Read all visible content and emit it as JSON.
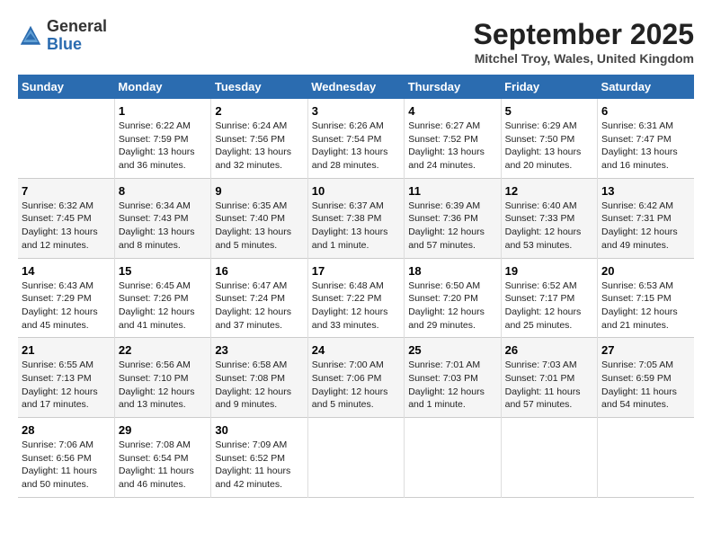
{
  "header": {
    "logo_general": "General",
    "logo_blue": "Blue",
    "month_title": "September 2025",
    "location": "Mitchel Troy, Wales, United Kingdom"
  },
  "days_of_week": [
    "Sunday",
    "Monday",
    "Tuesday",
    "Wednesday",
    "Thursday",
    "Friday",
    "Saturday"
  ],
  "weeks": [
    [
      {
        "day": "",
        "info": ""
      },
      {
        "day": "1",
        "info": "Sunrise: 6:22 AM\nSunset: 7:59 PM\nDaylight: 13 hours\nand 36 minutes."
      },
      {
        "day": "2",
        "info": "Sunrise: 6:24 AM\nSunset: 7:56 PM\nDaylight: 13 hours\nand 32 minutes."
      },
      {
        "day": "3",
        "info": "Sunrise: 6:26 AM\nSunset: 7:54 PM\nDaylight: 13 hours\nand 28 minutes."
      },
      {
        "day": "4",
        "info": "Sunrise: 6:27 AM\nSunset: 7:52 PM\nDaylight: 13 hours\nand 24 minutes."
      },
      {
        "day": "5",
        "info": "Sunrise: 6:29 AM\nSunset: 7:50 PM\nDaylight: 13 hours\nand 20 minutes."
      },
      {
        "day": "6",
        "info": "Sunrise: 6:31 AM\nSunset: 7:47 PM\nDaylight: 13 hours\nand 16 minutes."
      }
    ],
    [
      {
        "day": "7",
        "info": "Sunrise: 6:32 AM\nSunset: 7:45 PM\nDaylight: 13 hours\nand 12 minutes."
      },
      {
        "day": "8",
        "info": "Sunrise: 6:34 AM\nSunset: 7:43 PM\nDaylight: 13 hours\nand 8 minutes."
      },
      {
        "day": "9",
        "info": "Sunrise: 6:35 AM\nSunset: 7:40 PM\nDaylight: 13 hours\nand 5 minutes."
      },
      {
        "day": "10",
        "info": "Sunrise: 6:37 AM\nSunset: 7:38 PM\nDaylight: 13 hours\nand 1 minute."
      },
      {
        "day": "11",
        "info": "Sunrise: 6:39 AM\nSunset: 7:36 PM\nDaylight: 12 hours\nand 57 minutes."
      },
      {
        "day": "12",
        "info": "Sunrise: 6:40 AM\nSunset: 7:33 PM\nDaylight: 12 hours\nand 53 minutes."
      },
      {
        "day": "13",
        "info": "Sunrise: 6:42 AM\nSunset: 7:31 PM\nDaylight: 12 hours\nand 49 minutes."
      }
    ],
    [
      {
        "day": "14",
        "info": "Sunrise: 6:43 AM\nSunset: 7:29 PM\nDaylight: 12 hours\nand 45 minutes."
      },
      {
        "day": "15",
        "info": "Sunrise: 6:45 AM\nSunset: 7:26 PM\nDaylight: 12 hours\nand 41 minutes."
      },
      {
        "day": "16",
        "info": "Sunrise: 6:47 AM\nSunset: 7:24 PM\nDaylight: 12 hours\nand 37 minutes."
      },
      {
        "day": "17",
        "info": "Sunrise: 6:48 AM\nSunset: 7:22 PM\nDaylight: 12 hours\nand 33 minutes."
      },
      {
        "day": "18",
        "info": "Sunrise: 6:50 AM\nSunset: 7:20 PM\nDaylight: 12 hours\nand 29 minutes."
      },
      {
        "day": "19",
        "info": "Sunrise: 6:52 AM\nSunset: 7:17 PM\nDaylight: 12 hours\nand 25 minutes."
      },
      {
        "day": "20",
        "info": "Sunrise: 6:53 AM\nSunset: 7:15 PM\nDaylight: 12 hours\nand 21 minutes."
      }
    ],
    [
      {
        "day": "21",
        "info": "Sunrise: 6:55 AM\nSunset: 7:13 PM\nDaylight: 12 hours\nand 17 minutes."
      },
      {
        "day": "22",
        "info": "Sunrise: 6:56 AM\nSunset: 7:10 PM\nDaylight: 12 hours\nand 13 minutes."
      },
      {
        "day": "23",
        "info": "Sunrise: 6:58 AM\nSunset: 7:08 PM\nDaylight: 12 hours\nand 9 minutes."
      },
      {
        "day": "24",
        "info": "Sunrise: 7:00 AM\nSunset: 7:06 PM\nDaylight: 12 hours\nand 5 minutes."
      },
      {
        "day": "25",
        "info": "Sunrise: 7:01 AM\nSunset: 7:03 PM\nDaylight: 12 hours\nand 1 minute."
      },
      {
        "day": "26",
        "info": "Sunrise: 7:03 AM\nSunset: 7:01 PM\nDaylight: 11 hours\nand 57 minutes."
      },
      {
        "day": "27",
        "info": "Sunrise: 7:05 AM\nSunset: 6:59 PM\nDaylight: 11 hours\nand 54 minutes."
      }
    ],
    [
      {
        "day": "28",
        "info": "Sunrise: 7:06 AM\nSunset: 6:56 PM\nDaylight: 11 hours\nand 50 minutes."
      },
      {
        "day": "29",
        "info": "Sunrise: 7:08 AM\nSunset: 6:54 PM\nDaylight: 11 hours\nand 46 minutes."
      },
      {
        "day": "30",
        "info": "Sunrise: 7:09 AM\nSunset: 6:52 PM\nDaylight: 11 hours\nand 42 minutes."
      },
      {
        "day": "",
        "info": ""
      },
      {
        "day": "",
        "info": ""
      },
      {
        "day": "",
        "info": ""
      },
      {
        "day": "",
        "info": ""
      }
    ]
  ]
}
